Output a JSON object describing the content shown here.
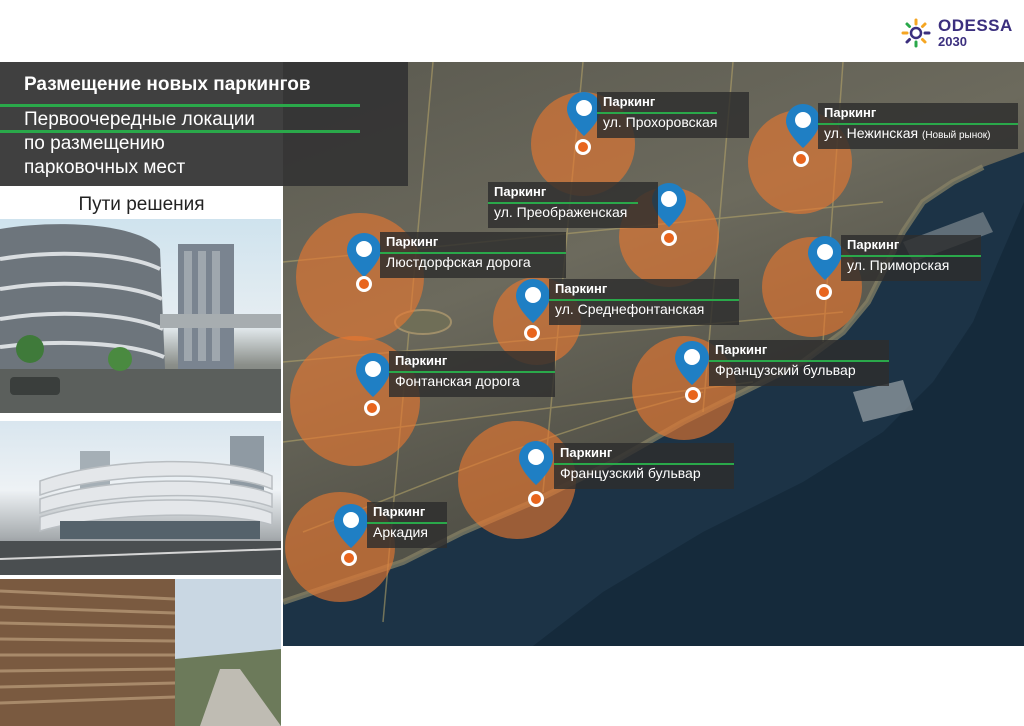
{
  "logo": {
    "line1": "ODESSA",
    "line2": "2030",
    "colors": [
      "#f5a623",
      "#3b2f7e",
      "#2aa84a"
    ]
  },
  "header": {
    "title": "Размещение новых паркингов",
    "subtitle_lines": [
      "Первоочередные локации",
      "по размещению",
      "парковочных мест"
    ]
  },
  "solutions": {
    "label": "Пути решения"
  },
  "parkings": [
    {
      "title": "Паркинг",
      "street": "ул. Прохоровская"
    },
    {
      "title": "Паркинг",
      "street": "ул. Нежинская",
      "note": "(Новый рынок)"
    },
    {
      "title": "Паркинг",
      "street": "ул. Преображенская"
    },
    {
      "title": "Паркинг",
      "street": "Люстдорфская дорога"
    },
    {
      "title": "Паркинг",
      "street": "ул. Приморская"
    },
    {
      "title": "Паркинг",
      "street": "ул. Среднефонтанская"
    },
    {
      "title": "Паркинг",
      "street": "Фонтанская дорога"
    },
    {
      "title": "Паркинг",
      "street": "Французский бульвар"
    },
    {
      "title": "Паркинг",
      "street": "Французский бульвар"
    },
    {
      "title": "Паркинг",
      "street": "Аркадия"
    }
  ],
  "colors": {
    "accent_green": "#2aa84a",
    "zone_orange": "#ea782e",
    "pin_blue": "#1f7fc4",
    "panel_dark": "#343434"
  }
}
